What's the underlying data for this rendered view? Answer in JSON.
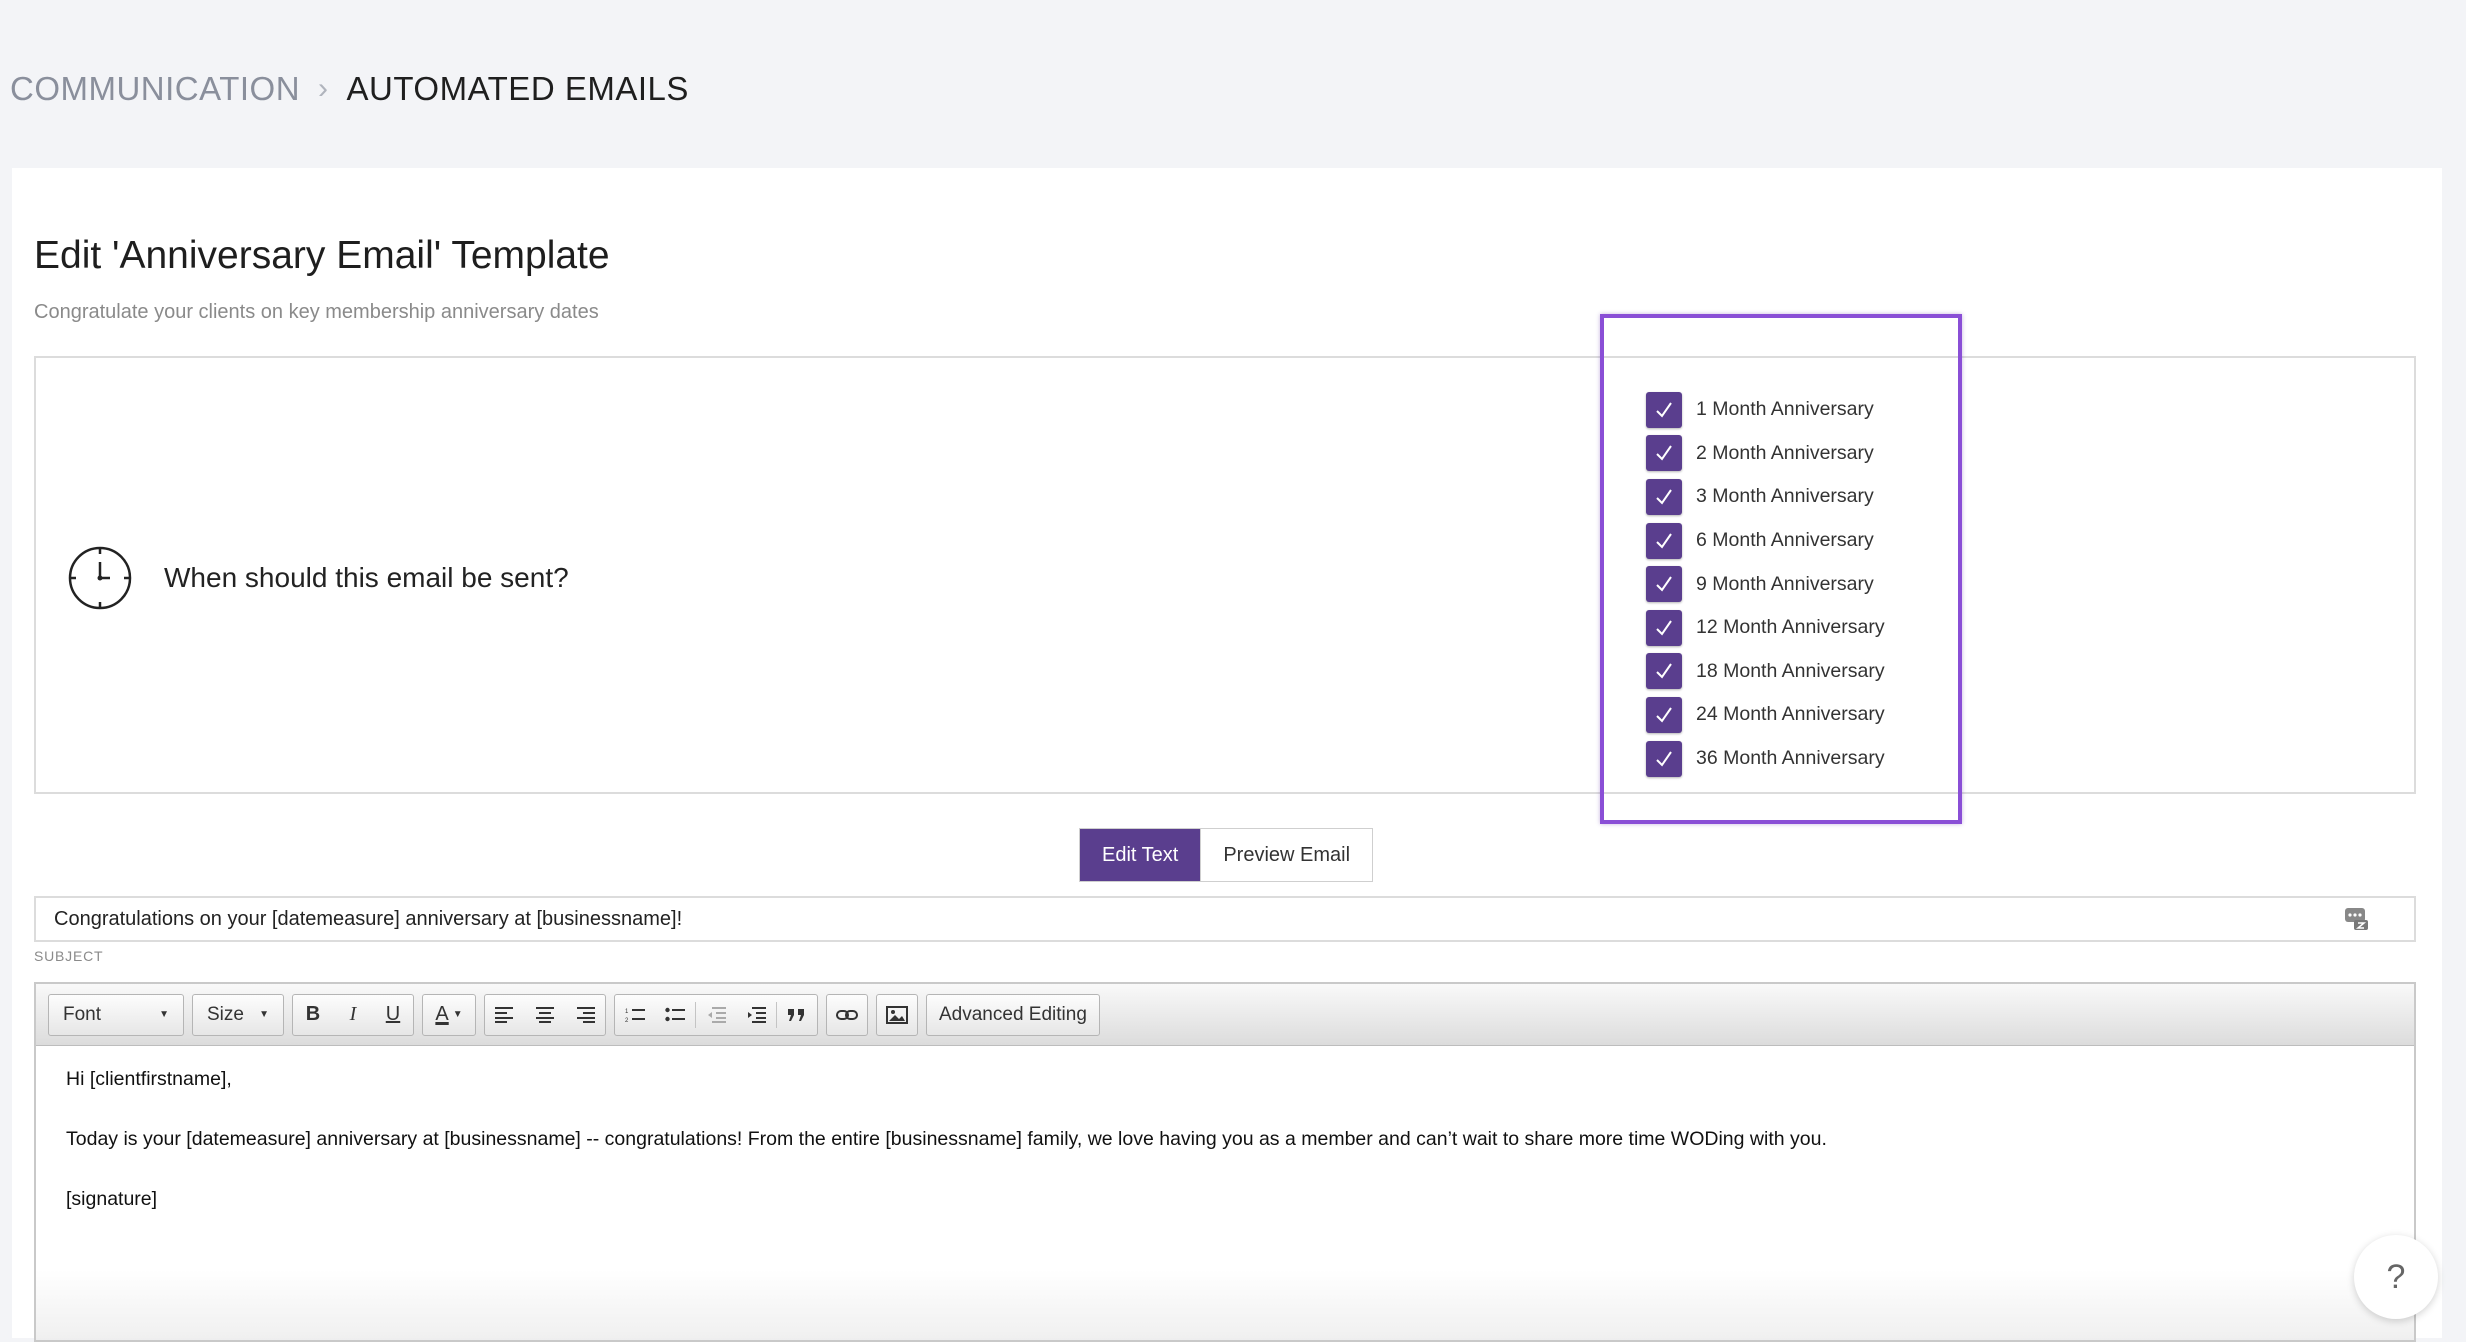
{
  "breadcrumb": {
    "parent": "COMMUNICATION",
    "separator": "›",
    "current": "AUTOMATED EMAILS"
  },
  "page": {
    "title": "Edit 'Anniversary Email' Template",
    "subtitle": "Congratulate your clients on key membership anniversary dates"
  },
  "schedule": {
    "question": "When should this email be sent?",
    "icon": "clock-icon",
    "accent_color": "#5a3e8e",
    "highlight_color": "#8a4fd6",
    "options": [
      {
        "label": "1 Month Anniversary",
        "checked": true
      },
      {
        "label": "2 Month Anniversary",
        "checked": true
      },
      {
        "label": "3 Month Anniversary",
        "checked": true
      },
      {
        "label": "6 Month Anniversary",
        "checked": true
      },
      {
        "label": "9 Month Anniversary",
        "checked": true
      },
      {
        "label": "12 Month Anniversary",
        "checked": true
      },
      {
        "label": "18 Month Anniversary",
        "checked": true
      },
      {
        "label": "24 Month Anniversary",
        "checked": true
      },
      {
        "label": "36 Month Anniversary",
        "checked": true
      }
    ]
  },
  "mode_toggle": {
    "edit_label": "Edit Text",
    "preview_label": "Preview Email",
    "active": "edit"
  },
  "subject": {
    "value": "Congratulations on your [datemeasure] anniversary at [businessname]!",
    "label": "SUBJECT",
    "merge_icon": "merge-fields-icon"
  },
  "toolbar": {
    "font_label": "Font",
    "size_label": "Size",
    "bold": "B",
    "italic": "I",
    "underline": "U",
    "font_color": "A",
    "advanced_label": "Advanced Editing"
  },
  "body": {
    "greeting": "Hi [clientfirstname],",
    "paragraph": "Today is your [datemeasure] anniversary at [businessname] -- congratulations! From the entire [businessname] family, we love having you as a member and can’t wait to share more time WODing with you.",
    "signature": "[signature]"
  },
  "help": {
    "label": "?"
  }
}
